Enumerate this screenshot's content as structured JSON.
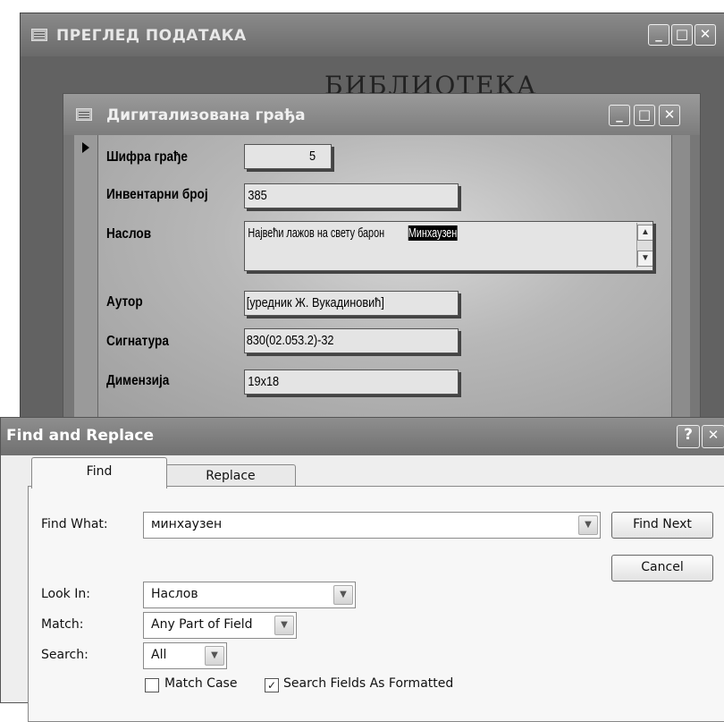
{
  "outer_window": {
    "title": "ПРЕГЛЕД ПОДАТАКА",
    "background_heading": "БИБЛИОТЕКА",
    "controls": {
      "minimize": "_",
      "maximize": "□",
      "close": "✕"
    }
  },
  "form_window": {
    "title": "Дигитализована  грађа",
    "controls": {
      "minimize": "_",
      "maximize": "□",
      "close": "✕"
    },
    "fields": {
      "sifra": {
        "label": "Шифра грађе",
        "value": "5"
      },
      "inventar": {
        "label": "Инвентарни број",
        "value": "385"
      },
      "naslov": {
        "label": "Наслов",
        "value_before": "Највећи лажов на свету барон ",
        "value_highlight": "Минхаузен"
      },
      "autor": {
        "label": "Аутор",
        "value": "[уредник Ж. Вукадиновић]"
      },
      "signatura": {
        "label": "Сигнатура",
        "value": "830(02.053.2)-32"
      },
      "dimenzija": {
        "label": "Димензија",
        "value": "19x18"
      }
    }
  },
  "find_dialog": {
    "title": "Find and Replace",
    "help": "?",
    "close": "✕",
    "tabs": [
      "Find",
      "Replace"
    ],
    "active_tab": "Find",
    "find_what": {
      "label": "Find What:",
      "value": "минхаузен"
    },
    "look_in": {
      "label": "Look In:",
      "value": "Наслов"
    },
    "match": {
      "label": "Match:",
      "value": "Any Part of Field"
    },
    "search": {
      "label": "Search:",
      "value": "All"
    },
    "buttons": {
      "find_next": "Find Next",
      "cancel": "Cancel"
    },
    "checkboxes": {
      "match_case": {
        "label": "Match Case",
        "checked": false
      },
      "search_formatted": {
        "label": "Search Fields As Formatted",
        "checked": true
      }
    }
  },
  "icons": {
    "dropdown": "chevron-down-icon",
    "scroll_up": "arrow-up-icon",
    "scroll_down": "arrow-down-icon",
    "record": "record-selector-icon",
    "check": "checkmark-icon"
  }
}
